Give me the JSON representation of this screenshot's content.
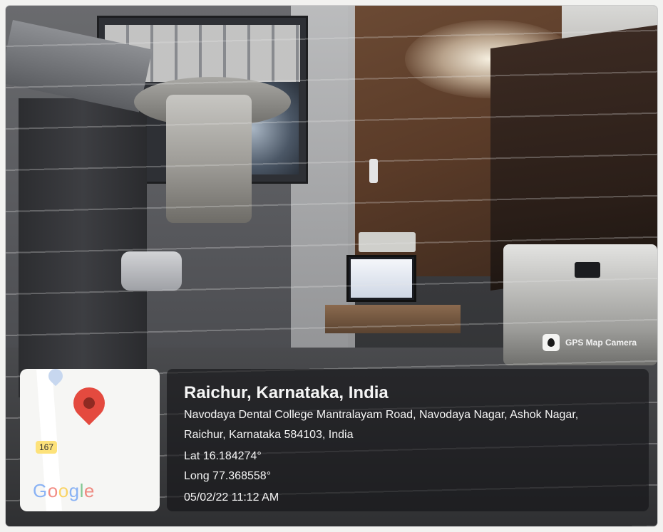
{
  "watermark": {
    "app_name": "GPS Map Camera",
    "icon": "gps-map-camera-logo-icon"
  },
  "map": {
    "road_number": "167",
    "brand": [
      "G",
      "o",
      "o",
      "g",
      "l",
      "e"
    ],
    "pin_icon": "map-pin-icon",
    "pin_color": "#e44a3f"
  },
  "location": {
    "title": "Raichur, Karnataka, India",
    "address_line1": "Navodaya Dental College Mantralayam Road, Navodaya Nagar, Ashok Nagar,",
    "address_line2": "Raichur, Karnataka 584103, India",
    "latitude": "Lat 16.184274°",
    "longitude": "Long 77.368558°",
    "datetime": "05/02/22 11:12 AM"
  },
  "overlay_color": "#141416"
}
